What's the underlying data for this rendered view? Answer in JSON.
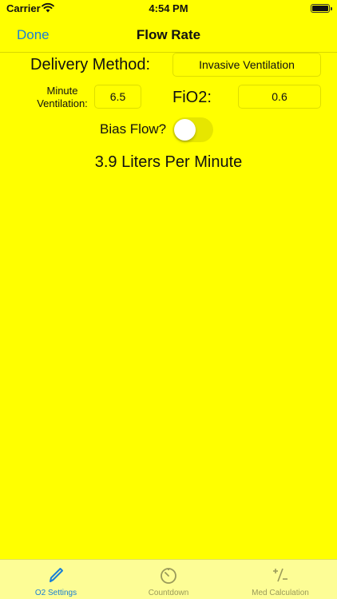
{
  "status_bar": {
    "carrier": "Carrier",
    "time": "4:54 PM"
  },
  "nav": {
    "done_label": "Done",
    "title": "Flow Rate"
  },
  "form": {
    "delivery_method_label": "Delivery Method:",
    "delivery_method_value": "Invasive Ventilation",
    "minute_ventilation_label_line1": "Minute",
    "minute_ventilation_label_line2": "Ventilation:",
    "minute_ventilation_value": "6.5",
    "fio2_label": "FiO2:",
    "fio2_value": "0.6",
    "bias_flow_label": "Bias Flow?",
    "bias_flow_on": false
  },
  "result": {
    "text": "3.9 Liters Per Minute"
  },
  "tabs": [
    {
      "label": "O2 Settings",
      "icon": "pencil-icon",
      "selected": true
    },
    {
      "label": "Countdown",
      "icon": "timer-icon",
      "selected": false
    },
    {
      "label": "Med Calculation",
      "icon": "plus-minus-icon",
      "selected": false
    }
  ],
  "colors": {
    "background": "#ffff00",
    "accent": "#1a7fd6",
    "tab_bar": "#fdfd96",
    "inactive_tab": "#9a9a5a"
  }
}
